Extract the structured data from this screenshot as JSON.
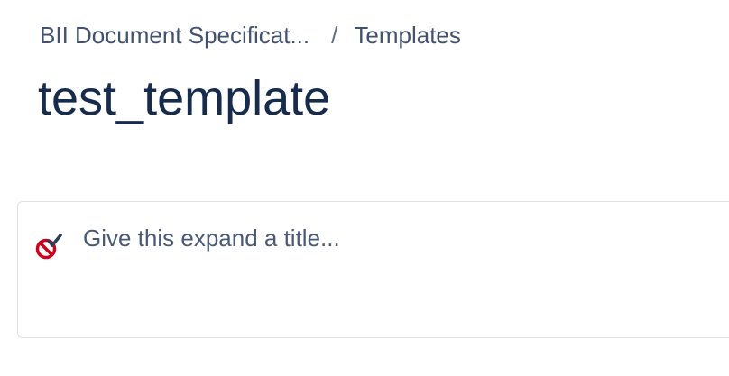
{
  "breadcrumb": {
    "items": [
      {
        "label": "BII Document Specificat..."
      },
      {
        "label": "Templates"
      }
    ],
    "separator": "/"
  },
  "page": {
    "title": "test_template"
  },
  "expand": {
    "title_placeholder": "Give this expand a title...",
    "title_value": "",
    "icon": "no-entry-checkmark-icon",
    "icon_colors": {
      "circle": "#d0021b",
      "check": "#2f3d55"
    }
  },
  "colors": {
    "text_primary": "#172b4d",
    "text_secondary": "#42526e",
    "border": "#dfe1e6"
  }
}
